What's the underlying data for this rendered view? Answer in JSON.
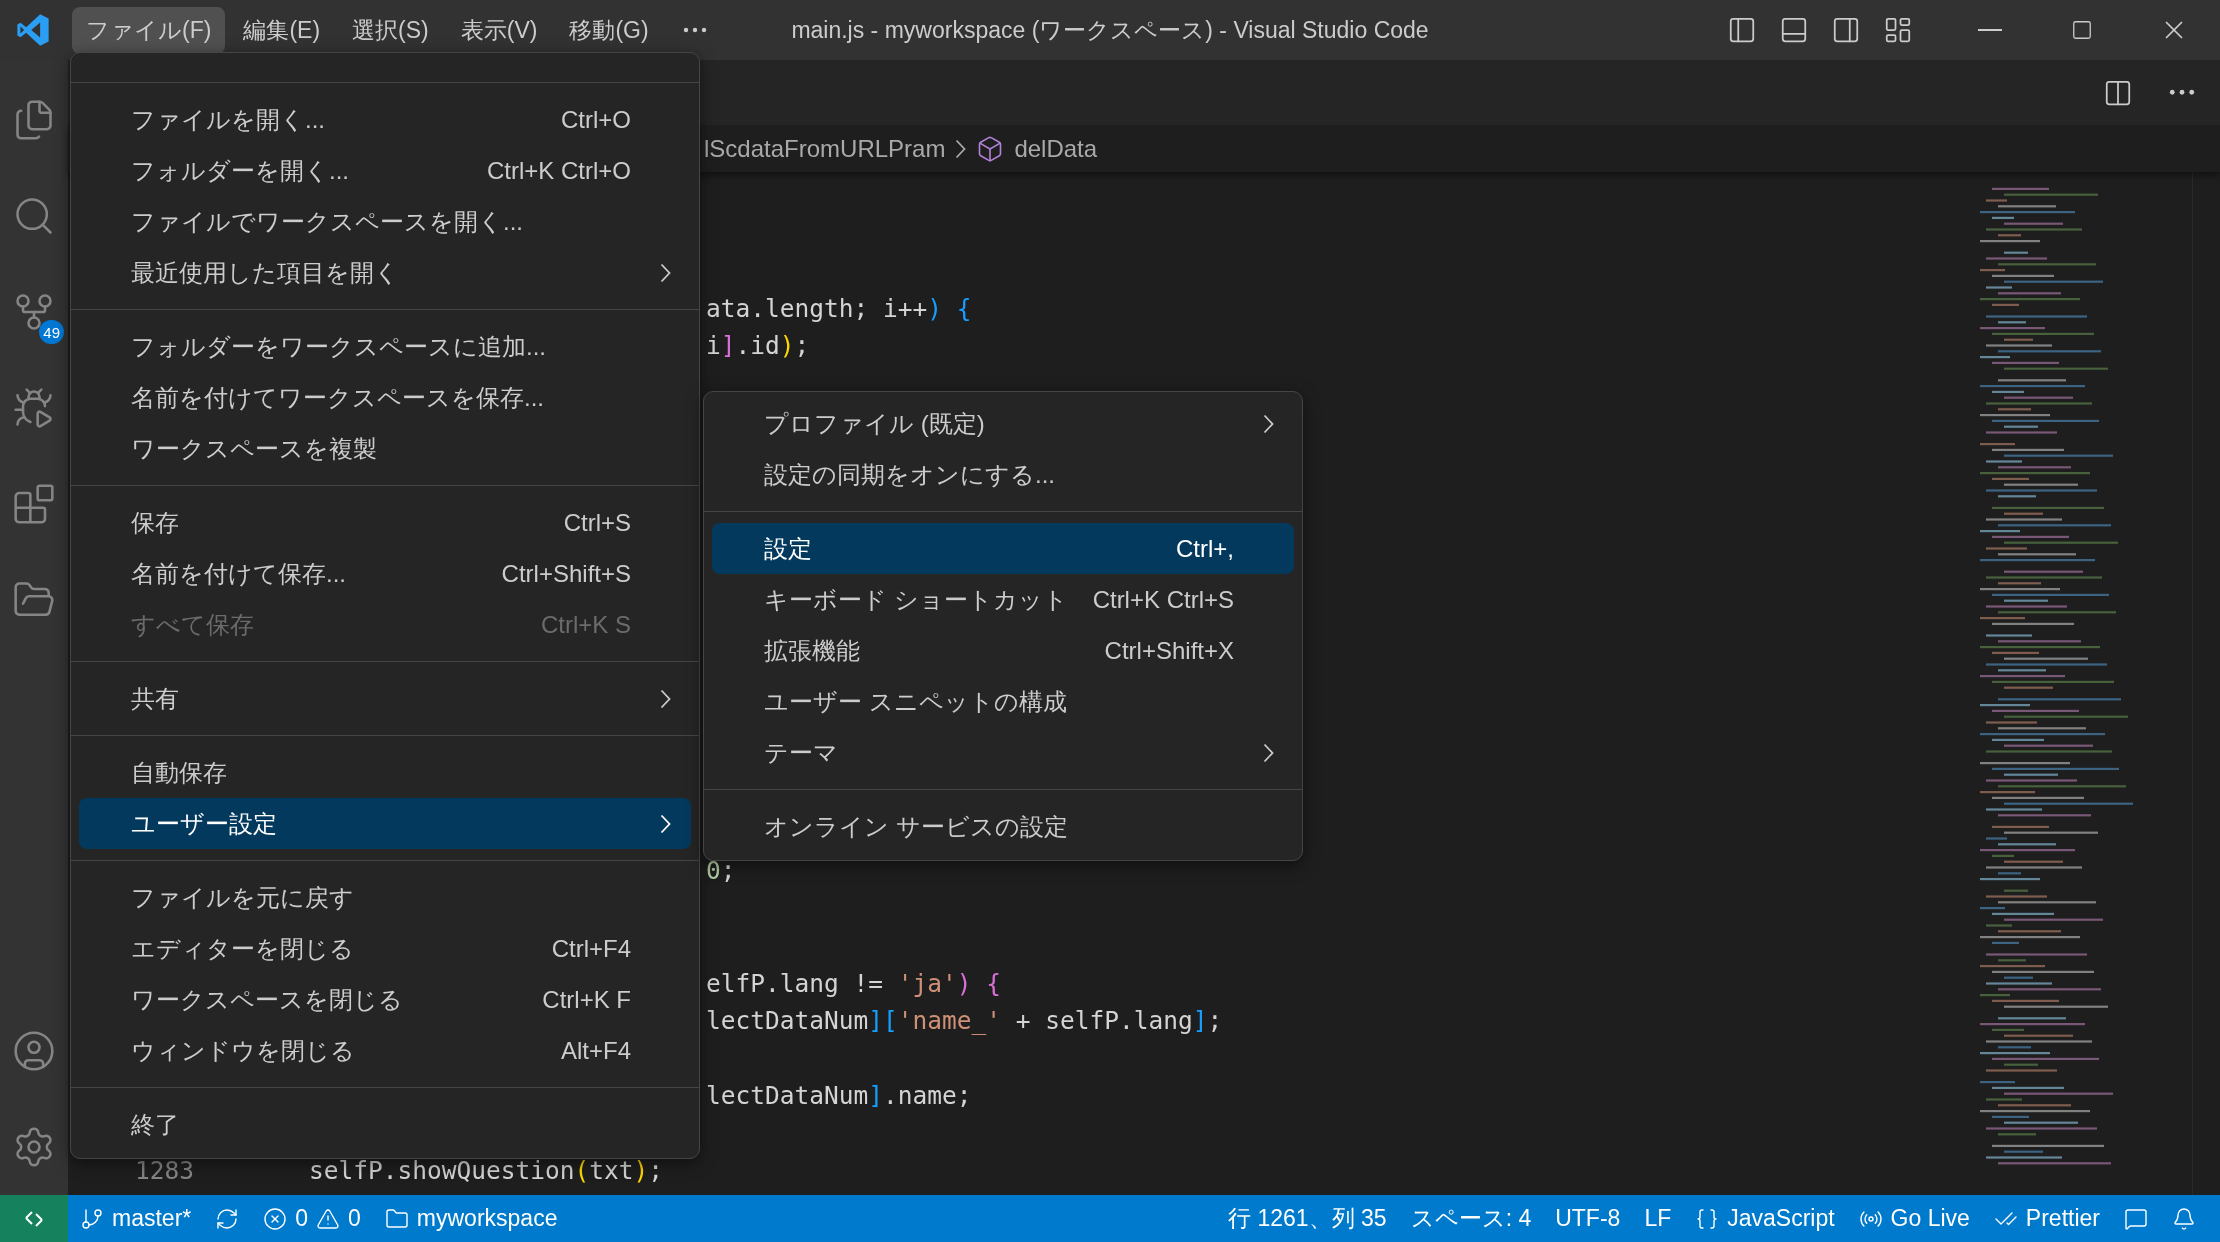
{
  "title_bar": {
    "menus": [
      {
        "label": "ファイル(F)",
        "selected": true
      },
      {
        "label": "編集(E)",
        "selected": false
      },
      {
        "label": "選択(S)",
        "selected": false
      },
      {
        "label": "表示(V)",
        "selected": false
      },
      {
        "label": "移動(G)",
        "selected": false
      }
    ],
    "title": "main.js - myworkspace (ワークスペース) - Visual Studio Code"
  },
  "activity_bar": {
    "source_control_badge": "49"
  },
  "breadcrumb": {
    "path": "lScdataFromURLPram",
    "symbol": "delData"
  },
  "editor": {
    "lines": [
      {
        "kind": "blank"
      },
      {
        "kind": "blank"
      },
      {
        "kind": "blank"
      },
      {
        "kind": "fragment",
        "tokens": [
          {
            "text": "ata.length; i++",
            "color": "#d4d4d4"
          },
          {
            "text": ") {",
            "color": "#179fff"
          }
        ]
      },
      {
        "kind": "fragment",
        "tokens": [
          {
            "text": "i",
            "color": "#d4d4d4"
          },
          {
            "text": "]",
            "color": "#da70d6"
          },
          {
            "text": ".id",
            "color": "#d4d4d4"
          },
          {
            "text": ")",
            "color": "#ffd700"
          },
          {
            "text": ";",
            "color": "#d4d4d4"
          }
        ]
      },
      {
        "kind": "blank"
      },
      {
        "kind": "blank"
      },
      {
        "kind": "blank"
      },
      {
        "kind": "blank"
      },
      {
        "kind": "blank"
      },
      {
        "kind": "blank"
      },
      {
        "kind": "blank"
      },
      {
        "kind": "blank"
      },
      {
        "kind": "blank"
      },
      {
        "kind": "blank"
      },
      {
        "kind": "blank"
      },
      {
        "kind": "blank"
      },
      {
        "kind": "blank"
      },
      {
        "kind": "fragment",
        "tokens": [
          {
            "text": "0",
            "color": "#b5cea8"
          },
          {
            "text": ";",
            "color": "#d4d4d4"
          }
        ]
      },
      {
        "kind": "blank"
      },
      {
        "kind": "blank"
      },
      {
        "kind": "fragment",
        "tokens": [
          {
            "text": "elfP.lang != ",
            "color": "#d4d4d4"
          },
          {
            "text": "'ja'",
            "color": "#ce9178"
          },
          {
            "text": ") {",
            "color": "#da70d6"
          }
        ]
      },
      {
        "kind": "fragment",
        "tokens": [
          {
            "text": "lectDataNum",
            "color": "#d4d4d4"
          },
          {
            "text": "][",
            "color": "#179fff"
          },
          {
            "text": "'name_'",
            "color": "#ce9178"
          },
          {
            "text": " + selfP.lang",
            "color": "#d4d4d4"
          },
          {
            "text": "]",
            "color": "#179fff"
          },
          {
            "text": ";",
            "color": "#d4d4d4"
          }
        ]
      },
      {
        "kind": "blank"
      },
      {
        "kind": "fragment",
        "tokens": [
          {
            "text": "lectDataNum",
            "color": "#d4d4d4"
          },
          {
            "text": "]",
            "color": "#179fff"
          },
          {
            "text": ".name;",
            "color": "#d4d4d4"
          }
        ]
      },
      {
        "kind": "blank"
      },
      {
        "kind": "numbered",
        "number": "1283",
        "tokens": [
          {
            "text": "selfP.showQuestion",
            "color": "#d4d4d4"
          },
          {
            "text": "(",
            "color": "#ffd700"
          },
          {
            "text": "txt",
            "color": "#d4d4d4"
          },
          {
            "text": ")",
            "color": "#ffd700"
          },
          {
            "text": ";",
            "color": "#d4d4d4"
          }
        ]
      }
    ]
  },
  "file_menu": {
    "groups": [
      {
        "items": [
          {
            "label": "ファイルを開く...",
            "shortcut": "Ctrl+O",
            "has_submenu": false,
            "disabled": false,
            "selected": false
          },
          {
            "label": "フォルダーを開く...",
            "shortcut": "Ctrl+K Ctrl+O",
            "has_submenu": false,
            "disabled": false,
            "selected": false
          },
          {
            "label": "ファイルでワークスペースを開く...",
            "has_submenu": false,
            "disabled": false,
            "selected": false
          },
          {
            "label": "最近使用した項目を開く",
            "has_submenu": true,
            "disabled": false,
            "selected": false
          }
        ]
      },
      {
        "items": [
          {
            "label": "フォルダーをワークスペースに追加...",
            "has_submenu": false,
            "disabled": false,
            "selected": false
          },
          {
            "label": "名前を付けてワークスペースを保存...",
            "has_submenu": false,
            "disabled": false,
            "selected": false
          },
          {
            "label": "ワークスペースを複製",
            "has_submenu": false,
            "disabled": false,
            "selected": false
          }
        ]
      },
      {
        "items": [
          {
            "label": "保存",
            "shortcut": "Ctrl+S",
            "has_submenu": false,
            "disabled": false,
            "selected": false
          },
          {
            "label": "名前を付けて保存...",
            "shortcut": "Ctrl+Shift+S",
            "has_submenu": false,
            "disabled": false,
            "selected": false
          },
          {
            "label": "すべて保存",
            "shortcut": "Ctrl+K S",
            "has_submenu": false,
            "disabled": true,
            "selected": false
          }
        ]
      },
      {
        "items": [
          {
            "label": "共有",
            "has_submenu": true,
            "disabled": false,
            "selected": false
          }
        ]
      },
      {
        "items": [
          {
            "label": "自動保存",
            "has_submenu": false,
            "disabled": false,
            "selected": false
          },
          {
            "label": "ユーザー設定",
            "has_submenu": true,
            "disabled": false,
            "selected": true
          }
        ]
      },
      {
        "items": [
          {
            "label": "ファイルを元に戻す",
            "has_submenu": false,
            "disabled": false,
            "selected": false
          },
          {
            "label": "エディターを閉じる",
            "shortcut": "Ctrl+F4",
            "has_submenu": false,
            "disabled": false,
            "selected": false
          },
          {
            "label": "ワークスペースを閉じる",
            "shortcut": "Ctrl+K F",
            "has_submenu": false,
            "disabled": false,
            "selected": false
          },
          {
            "label": "ウィンドウを閉じる",
            "shortcut": "Alt+F4",
            "has_submenu": false,
            "disabled": false,
            "selected": false
          }
        ]
      },
      {
        "items": [
          {
            "label": "終了",
            "has_submenu": false,
            "disabled": false,
            "selected": false
          }
        ]
      }
    ]
  },
  "preferences_menu": {
    "groups": [
      {
        "items": [
          {
            "label": "プロファイル (既定)",
            "has_submenu": true,
            "disabled": false,
            "selected": false
          },
          {
            "label": "設定の同期をオンにする...",
            "has_submenu": false,
            "disabled": false,
            "selected": false
          }
        ]
      },
      {
        "items": [
          {
            "label": "設定",
            "shortcut": "Ctrl+,",
            "has_submenu": false,
            "disabled": false,
            "selected": true
          },
          {
            "label": "キーボード ショートカット",
            "shortcut": "Ctrl+K Ctrl+S",
            "has_submenu": false,
            "disabled": false,
            "selected": false
          },
          {
            "label": "拡張機能",
            "shortcut": "Ctrl+Shift+X",
            "has_submenu": false,
            "disabled": false,
            "selected": false
          },
          {
            "label": "ユーザー スニペットの構成",
            "has_submenu": false,
            "disabled": false,
            "selected": false
          },
          {
            "label": "テーマ",
            "has_submenu": true,
            "disabled": false,
            "selected": false
          }
        ]
      },
      {
        "items": [
          {
            "label": "オンライン サービスの設定",
            "has_submenu": false,
            "disabled": false,
            "selected": false
          }
        ]
      }
    ]
  },
  "status_bar": {
    "branch": "master*",
    "errors": "0",
    "warnings": "0",
    "folder": "myworkspace",
    "position": "行 1261、列 35",
    "indent": "スペース: 4",
    "encoding": "UTF-8",
    "eol": "LF",
    "language": "JavaScript",
    "go_live": "Go Live",
    "formatter": "Prettier"
  }
}
